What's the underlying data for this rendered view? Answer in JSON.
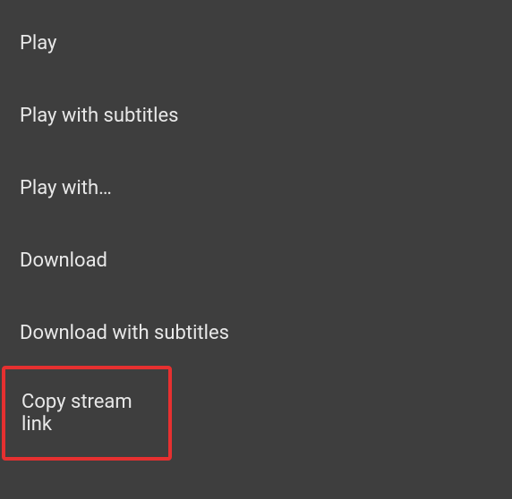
{
  "menu": {
    "items": [
      {
        "label": "Play"
      },
      {
        "label": "Play with subtitles"
      },
      {
        "label": "Play with…"
      },
      {
        "label": "Download"
      },
      {
        "label": "Download with subtitles"
      },
      {
        "label": "Copy stream link",
        "highlighted": true
      }
    ]
  },
  "colors": {
    "background": "#3e3e3e",
    "text": "#e8e8e8",
    "highlight_border": "#e63030"
  }
}
